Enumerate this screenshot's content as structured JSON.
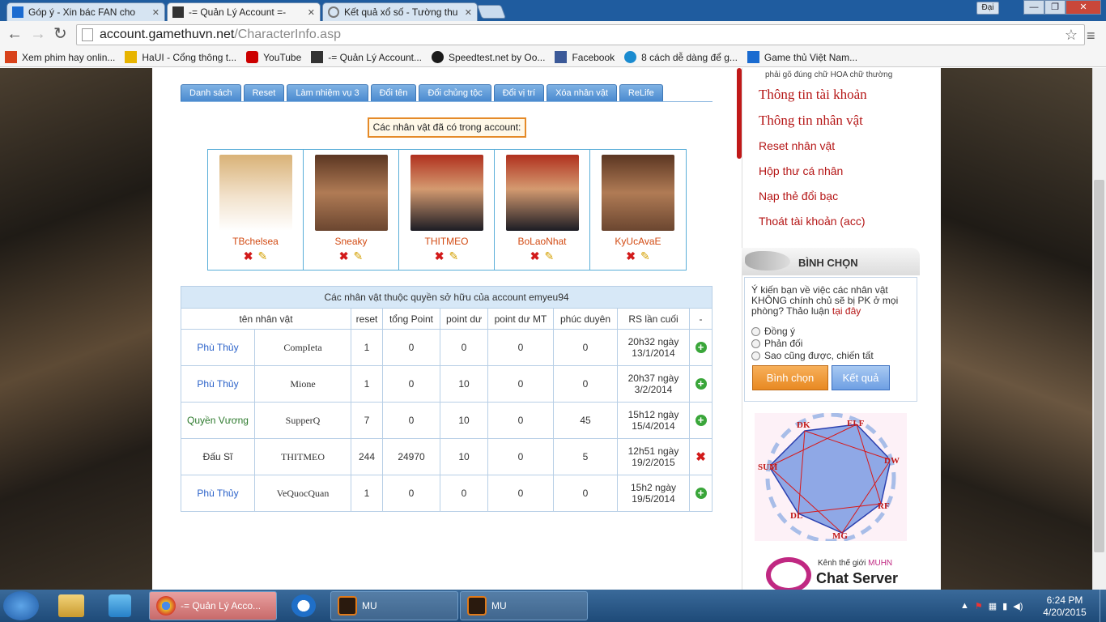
{
  "browser": {
    "tabs": [
      {
        "title": "Góp ý - Xin bác FAN cho"
      },
      {
        "title": "-= Quản Lý Account =-"
      },
      {
        "title": "Kết quả xổ số - Tường thu"
      }
    ],
    "user_button": "Đại",
    "url_host": "account.gamethuvn.net",
    "url_path": "/CharacterInfo.asp",
    "bookmarks": [
      {
        "label": "Xem phim hay onlin...",
        "icon_color": "#d8421b"
      },
      {
        "label": "HaUI - Cổng thông t...",
        "icon_color": "#e7b400"
      },
      {
        "label": "YouTube",
        "icon_color": "#cc0000"
      },
      {
        "label": "-= Quản Lý Account...",
        "icon_color": "#333333"
      },
      {
        "label": "Speedtest.net by Oo...",
        "icon_color": "#1a1a1a"
      },
      {
        "label": "Facebook",
        "icon_color": "#3b5998"
      },
      {
        "label": "8 cách dễ dàng để g...",
        "icon_color": "#1a8bd0"
      },
      {
        "label": "Game thủ Việt Nam...",
        "icon_color": "#1a6bd0"
      }
    ]
  },
  "menu_tabs": [
    "Danh sách",
    "Reset",
    "Làm nhiệm vụ 3",
    "Đổi tên",
    "Đổi chủng tộc",
    "Đổi vị trí",
    "Xóa nhân vật",
    "ReLife"
  ],
  "account_chars_label": "Các nhân vật đã có trong account:",
  "characters": [
    {
      "name": "TBchelsea",
      "color": "#e8c9a0"
    },
    {
      "name": "Sneaky",
      "color": "#8a5a3a"
    },
    {
      "name": "THITMEO",
      "color": "#b0382a"
    },
    {
      "name": "BoLaoNhat",
      "color": "#b0382a"
    },
    {
      "name": "KyUcAvaE",
      "color": "#8a5a3a"
    }
  ],
  "ownership": {
    "caption": "Các nhân vật thuộc quyền sở hữu của account emyeu94",
    "headers": [
      "tên nhân vật",
      "reset",
      "tổng Point",
      "point dư",
      "point dư MT",
      "phúc duyên",
      "RS lần cuối",
      "-"
    ],
    "rows": [
      {
        "class": "Phù Thủy",
        "class_color": "#2b62c9",
        "name": "CompIeta",
        "reset": "1",
        "total": "0",
        "point": "0",
        "point_mt": "0",
        "fortune": "0",
        "rs_time": "20h32 ngày",
        "rs_date": "13/1/2014",
        "action": "plus"
      },
      {
        "class": "Phù Thủy",
        "class_color": "#2b62c9",
        "name": "Mione",
        "reset": "1",
        "total": "0",
        "point": "10",
        "point_mt": "0",
        "fortune": "0",
        "rs_time": "20h37 ngày",
        "rs_date": "3/2/2014",
        "action": "plus"
      },
      {
        "class": "Quyền Vương",
        "class_color": "#2d7a2d",
        "name": "SupperQ",
        "reset": "7",
        "total": "0",
        "point": "10",
        "point_mt": "0",
        "fortune": "45",
        "rs_time": "15h12 ngày",
        "rs_date": "15/4/2014",
        "action": "plus"
      },
      {
        "class": "Đấu Sĩ",
        "class_color": "#333333",
        "name": "THITMEO",
        "reset": "244",
        "total": "24970",
        "point": "10",
        "point_mt": "0",
        "fortune": "5",
        "rs_time": "12h51 ngày",
        "rs_date": "19/2/2015",
        "action": "remove"
      },
      {
        "class": "Phù Thủy",
        "class_color": "#2b62c9",
        "name": "VeQuocQuan",
        "reset": "1",
        "total": "0",
        "point": "0",
        "point_mt": "0",
        "fortune": "0",
        "rs_time": "15h2 ngày",
        "rs_date": "19/5/2014",
        "action": "plus"
      }
    ]
  },
  "sidebar": {
    "note": "phải gõ đúng chữ HOA chữ thường",
    "links": [
      "Thông tin tài khoản",
      "Thông tin nhân vật",
      "Reset nhân vật",
      "Hộp thư cá nhân",
      "Nạp thẻ đổi bạc",
      "Thoát tài khoản (acc)"
    ],
    "poll": {
      "title": "BÌNH CHỌN",
      "question": "Ý kiến bạn về việc các nhân vật KHÔNG chính chủ sẽ bị PK ở mọi phòng? Thảo luận",
      "question_link": "tại đây",
      "options": [
        "Đồng ý",
        "Phản đối",
        "Sao cũng được, chiến tất"
      ],
      "vote_button": "Bình chọn",
      "result_button": "Kết quả"
    },
    "class_chart_labels": [
      "DK",
      "ELF",
      "DW",
      "RF",
      "MG",
      "DL",
      "SUM"
    ],
    "chat": {
      "line1": "Kênh thế giới",
      "line1_brand": "MUHN",
      "line2": "Chat Server"
    }
  },
  "taskbar": {
    "items": [
      "-= Quản Lý Acco...",
      "MU",
      "MU"
    ],
    "time": "6:24 PM",
    "date": "4/20/2015"
  }
}
